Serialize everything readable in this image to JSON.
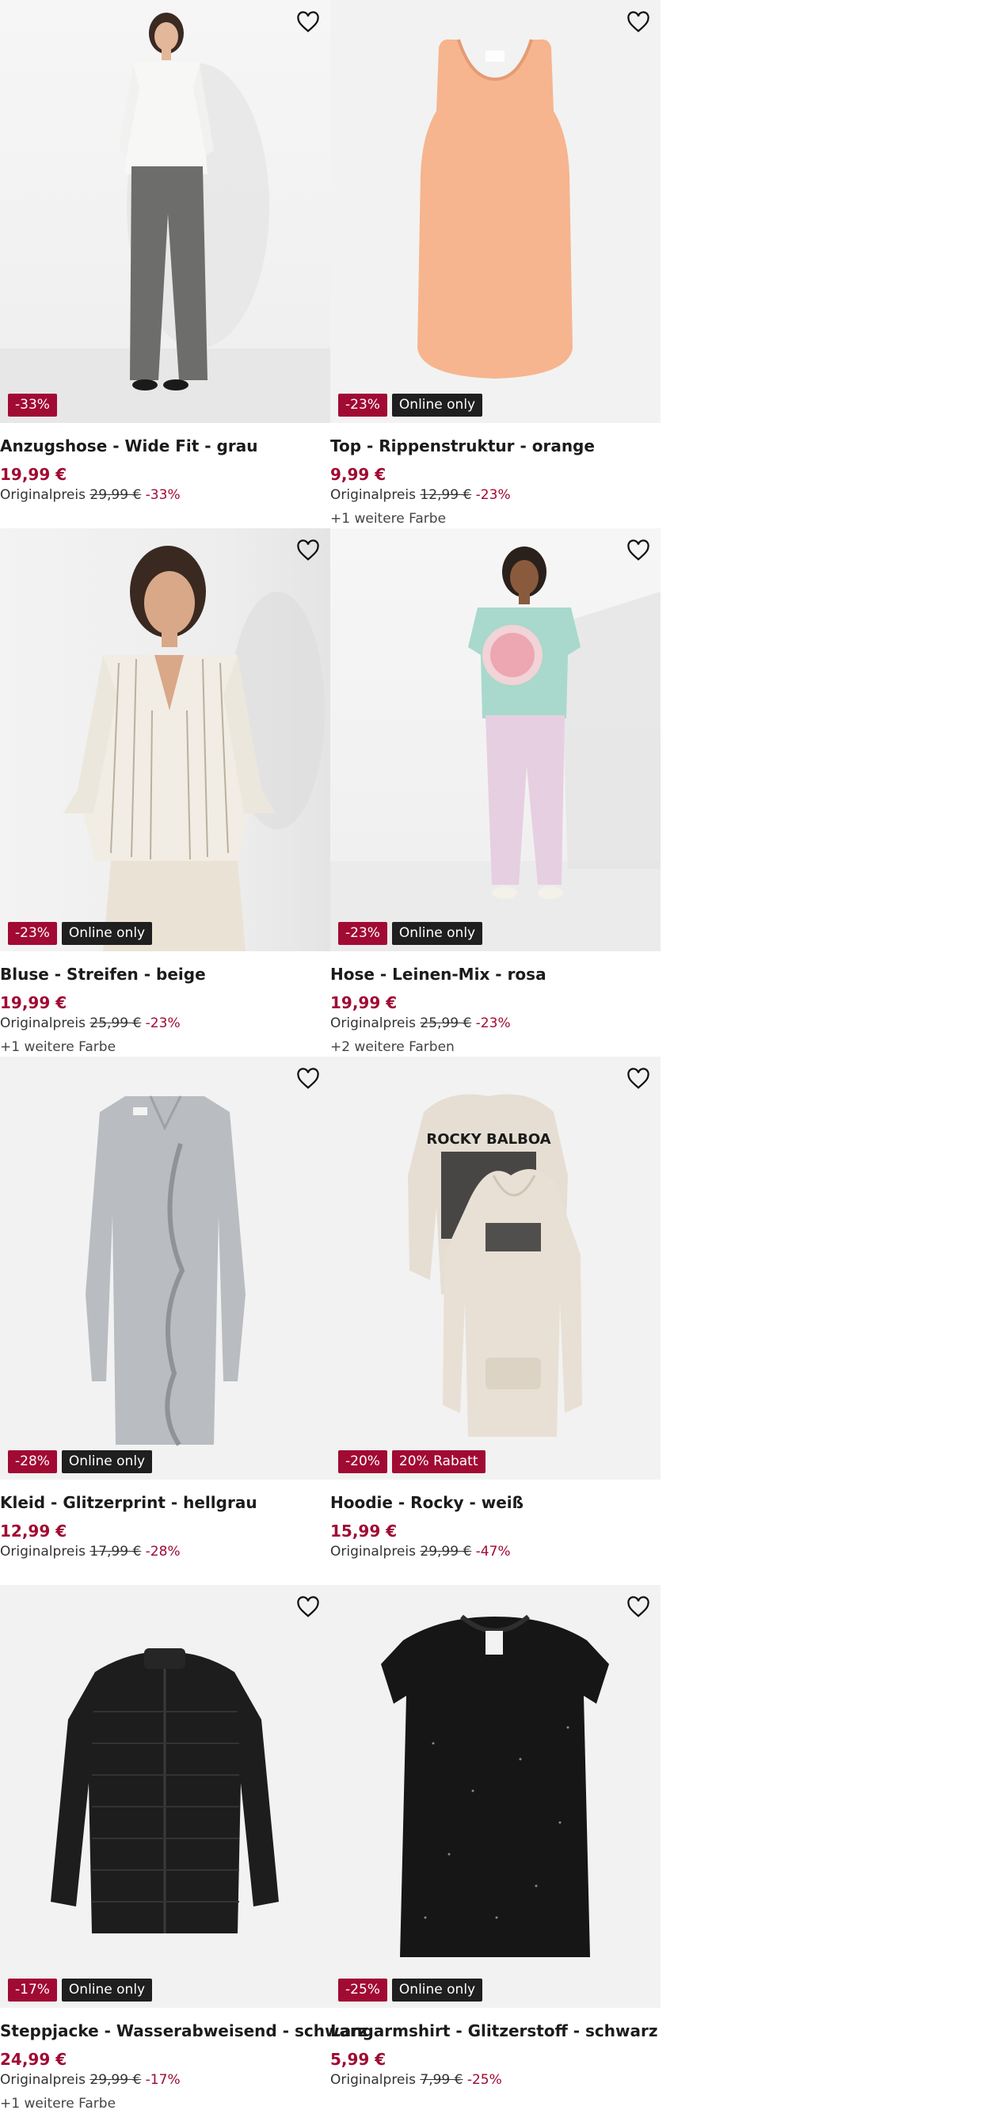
{
  "original_price_label": "Originalpreis",
  "products": [
    {
      "name": "Anzugshose - Wide Fit - grau",
      "price": "19,99 €",
      "original": "29,99 €",
      "discount_text": "-33%",
      "badge_discount": "-33%",
      "badge_tag": "",
      "more_colors": ""
    },
    {
      "name": "Top - Rippenstruktur - orange",
      "price": "9,99 €",
      "original": "12,99 €",
      "discount_text": "-23%",
      "badge_discount": "-23%",
      "badge_tag": "Online only",
      "more_colors": "+1 weitere Farbe"
    },
    {
      "name": "Bluse - Streifen - beige",
      "price": "19,99 €",
      "original": "25,99 €",
      "discount_text": "-23%",
      "badge_discount": "-23%",
      "badge_tag": "Online only",
      "more_colors": "+1 weitere Farbe"
    },
    {
      "name": "Hose - Leinen-Mix - rosa",
      "price": "19,99 €",
      "original": "25,99 €",
      "discount_text": "-23%",
      "badge_discount": "-23%",
      "badge_tag": "Online only",
      "more_colors": "+2 weitere Farben"
    },
    {
      "name": "Kleid - Glitzerprint - hellgrau",
      "price": "12,99 €",
      "original": "17,99 €",
      "discount_text": "-28%",
      "badge_discount": "-28%",
      "badge_tag": "Online only",
      "more_colors": ""
    },
    {
      "name": "Hoodie - Rocky - weiß",
      "price": "15,99 €",
      "original": "29,99 €",
      "discount_text": "-47%",
      "badge_discount": "-20%",
      "badge_tag": "20% Rabatt",
      "badge_tag_red": true,
      "more_colors": "",
      "print_text": "ROCKY BALBOA"
    },
    {
      "name": "Steppjacke - Wasserabweisend - schwarz",
      "price": "24,99 €",
      "original": "29,99 €",
      "discount_text": "-17%",
      "badge_discount": "-17%",
      "badge_tag": "Online only",
      "more_colors": "+1 weitere Farbe"
    },
    {
      "name": "Langarmshirt - Glitzerstoff - schwarz",
      "price": "5,99 €",
      "original": "7,99 €",
      "discount_text": "-25%",
      "badge_discount": "-25%",
      "badge_tag": "Online only",
      "more_colors": ""
    }
  ],
  "colors": {
    "discount": "#a10a33",
    "dark_badge": "#1f1f1f"
  },
  "icons": {
    "wishlist": "heart-outline-icon"
  }
}
